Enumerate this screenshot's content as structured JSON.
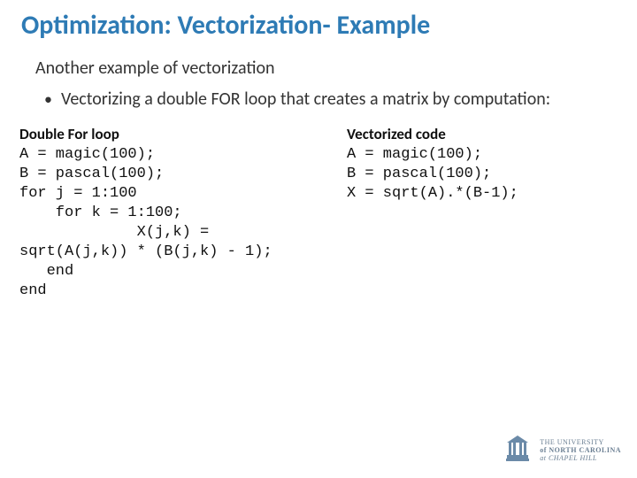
{
  "title": "Optimization: Vectorization- Example",
  "subtitle": "Another example of vectorization",
  "bullet": "Vectorizing a double FOR loop that creates a matrix by computation:",
  "left": {
    "heading": "Double For loop",
    "code": "A = magic(100);\nB = pascal(100);\nfor j = 1:100\n    for k = 1:100;\n             X(j,k) =\nsqrt(A(j,k)) * (B(j,k) - 1);\n   end\nend"
  },
  "right": {
    "heading": "Vectorized code",
    "code": "A = magic(100);\nB = pascal(100);\nX = sqrt(A).*(B-1);"
  },
  "logo": {
    "line1": "THE UNIVERSITY",
    "line2": "of NORTH CAROLINA",
    "line3": "at CHAPEL HILL"
  }
}
